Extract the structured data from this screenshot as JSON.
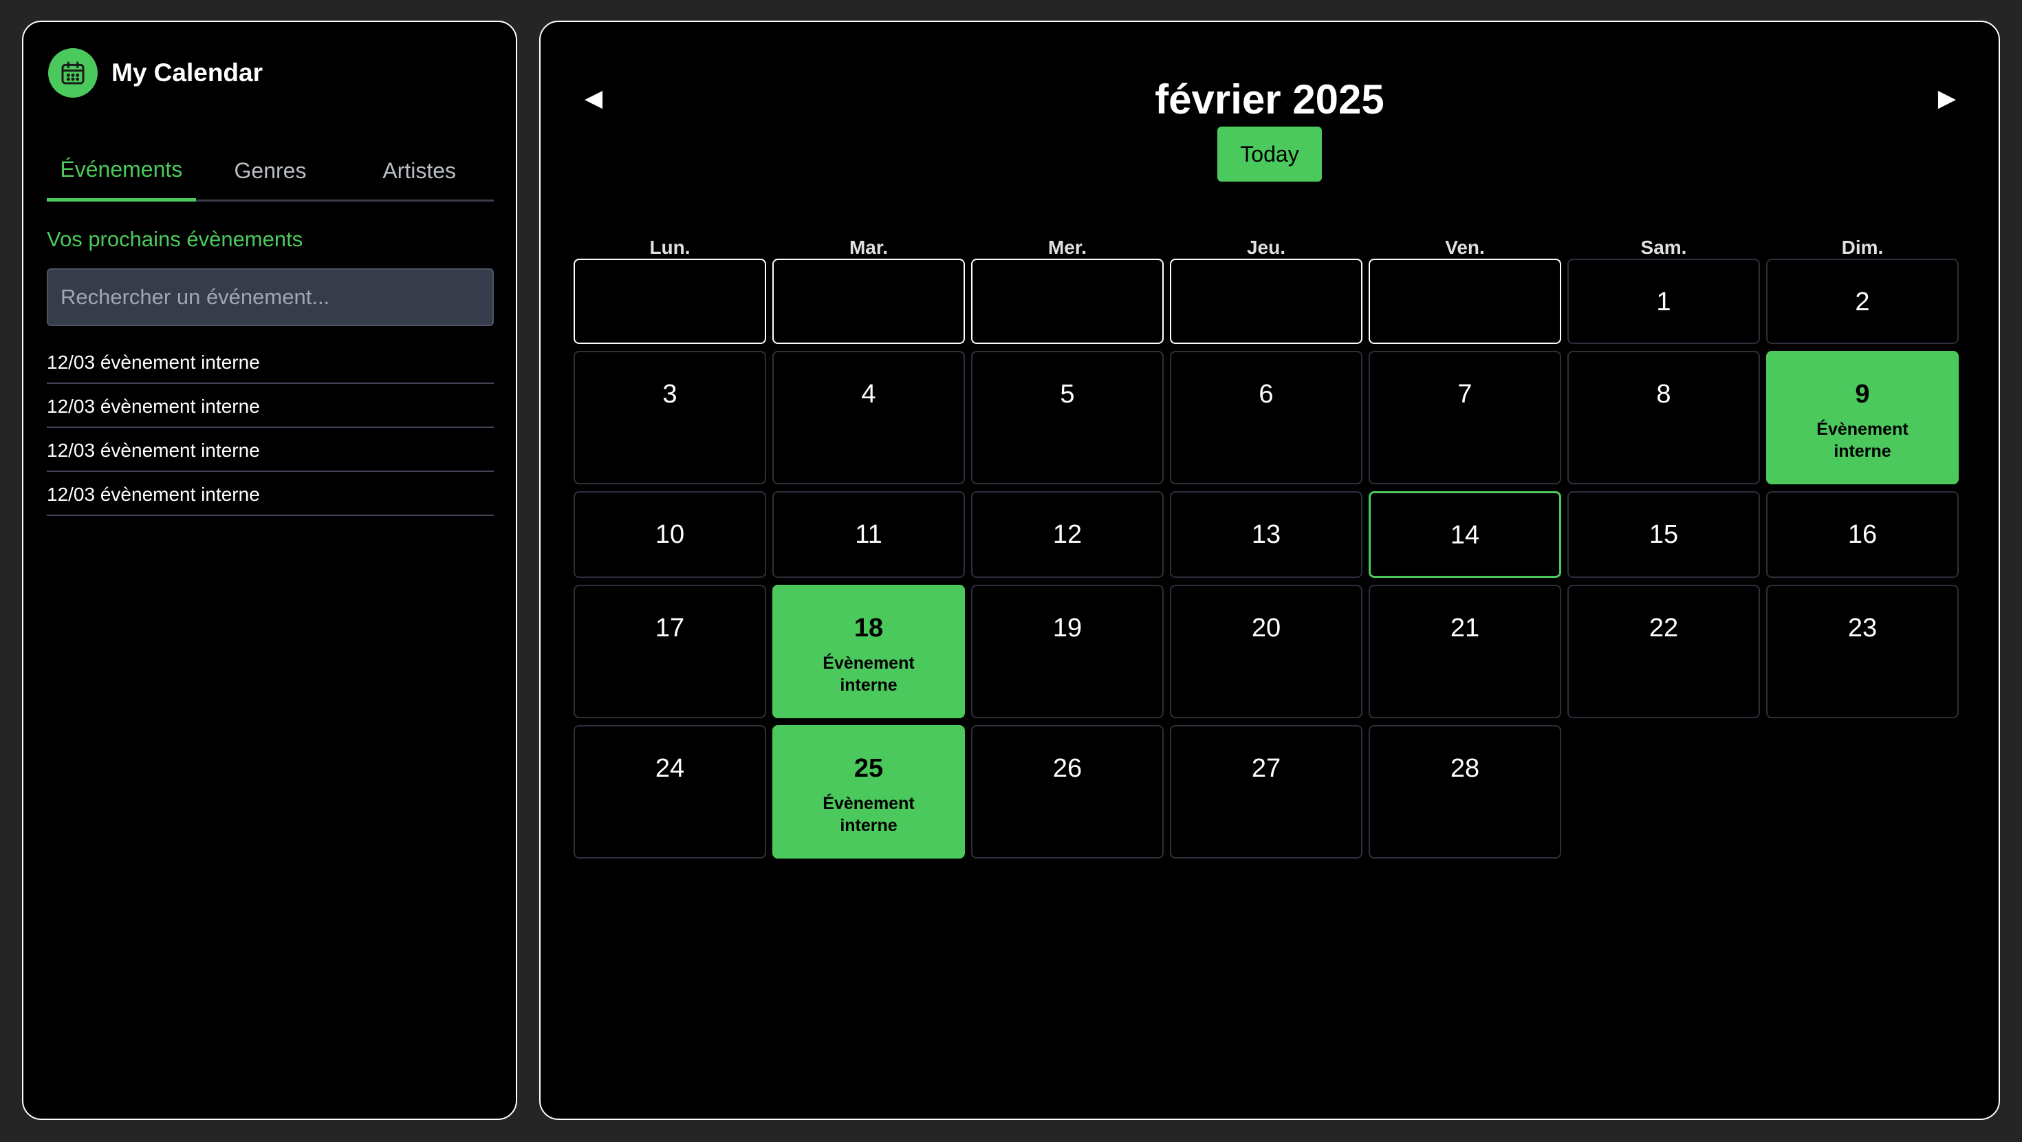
{
  "colors": {
    "accent": "#4cc95c",
    "background": "#252525",
    "panel": "#000000"
  },
  "sidebar": {
    "brand": {
      "icon": "calendar-icon",
      "title": "My Calendar"
    },
    "tabs": [
      {
        "label": "Événements",
        "active": true
      },
      {
        "label": "Genres",
        "active": false
      },
      {
        "label": "Artistes",
        "active": false
      }
    ],
    "section_title": "Vos prochains évènements",
    "search": {
      "value": "",
      "placeholder": "Rechercher un événement..."
    },
    "events": [
      "12/03 évènement interne",
      "12/03 évènement interne",
      "12/03 évènement interne",
      "12/03 évènement interne"
    ]
  },
  "calendar": {
    "prev_icon": "◀",
    "next_icon": "▶",
    "month_title": "février 2025",
    "today_label": "Today",
    "weekdays": [
      "Lun.",
      "Mar.",
      "Mer.",
      "Jeu.",
      "Ven.",
      "Sam.",
      "Dim."
    ],
    "leading_empty_days": 5,
    "days_in_month": 28,
    "today": 14,
    "events": [
      {
        "day": 9,
        "label": "Évènement interne"
      },
      {
        "day": 18,
        "label": "Évènement interne"
      },
      {
        "day": 25,
        "label": "Évènement interne"
      }
    ]
  }
}
